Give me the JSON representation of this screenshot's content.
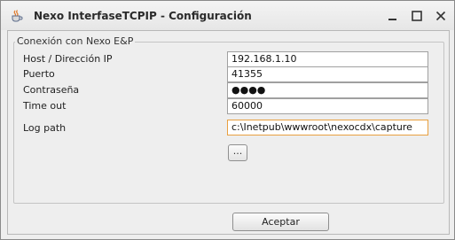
{
  "window": {
    "title": "Nexo InterfaseTCPIP - Configuración",
    "icons": {
      "app": "java-coffee-cup-icon",
      "minimize": "minimize-icon",
      "maximize": "maximize-icon",
      "close": "close-icon"
    }
  },
  "group": {
    "legend": "Conexión con Nexo E&P"
  },
  "fields": {
    "host": {
      "label": "Host / Dirección IP",
      "value": "192.168.1.10"
    },
    "port": {
      "label": "Puerto",
      "value": "41355"
    },
    "password": {
      "label": "Contraseña",
      "value": "●●●●"
    },
    "timeout": {
      "label": "Time out",
      "value": "60000"
    },
    "logpath": {
      "label": "Log path",
      "value": "c:\\Inetpub\\wwwroot\\nexocdx\\capture"
    }
  },
  "buttons": {
    "browse": "...",
    "accept": "Aceptar"
  }
}
